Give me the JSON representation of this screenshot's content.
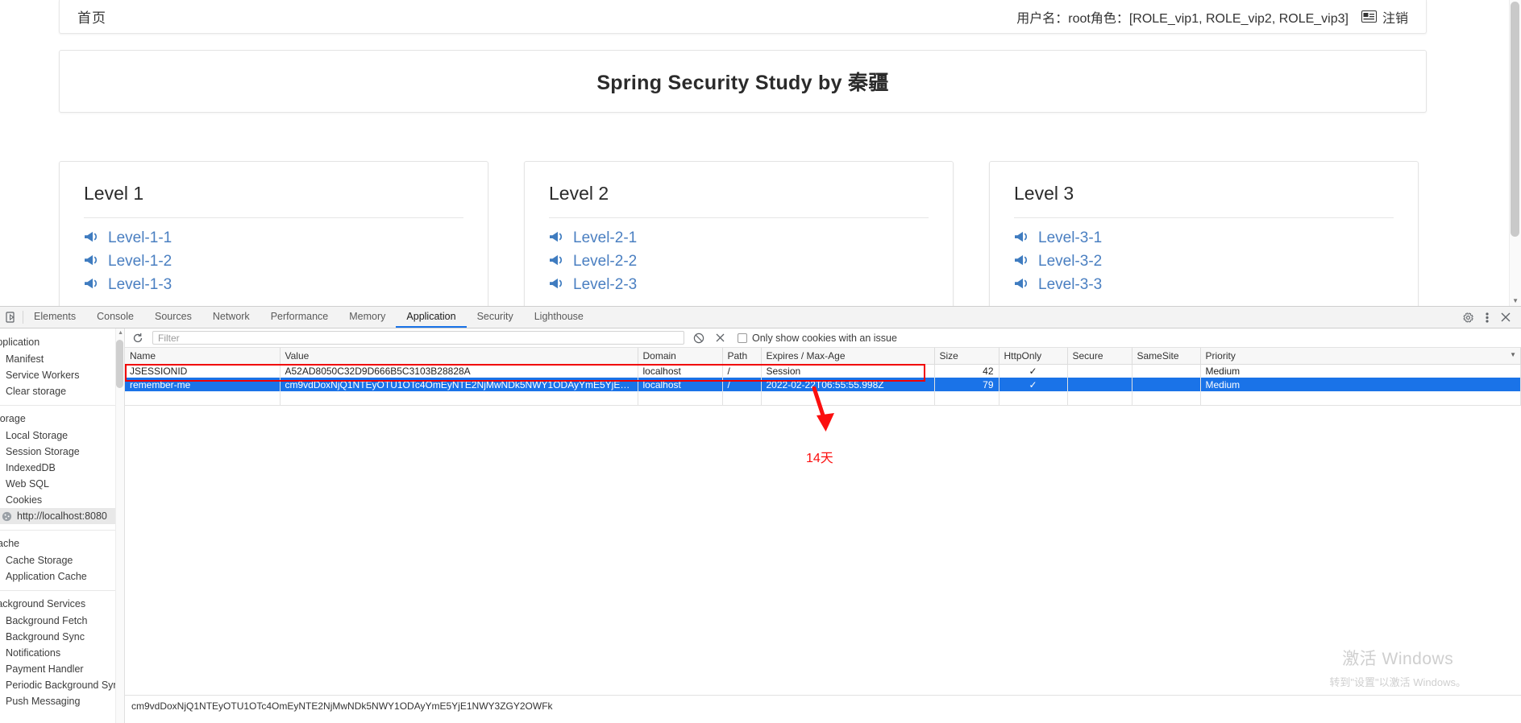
{
  "page": {
    "navbar": {
      "brand": "首页",
      "user_info": "用户名：root角色：[ROLE_vip1, ROLE_vip2, ROLE_vip3]",
      "logout_label": "注销",
      "logout_icon": "logout-card-icon"
    },
    "hero_title": "Spring Security Study by 秦疆",
    "cards": [
      {
        "title": "Level 1",
        "links": [
          "Level-1-1",
          "Level-1-2",
          "Level-1-3"
        ]
      },
      {
        "title": "Level 2",
        "links": [
          "Level-2-1",
          "Level-2-2",
          "Level-2-3"
        ]
      },
      {
        "title": "Level 3",
        "links": [
          "Level-3-1",
          "Level-3-2",
          "Level-3-3"
        ]
      }
    ],
    "link_icon": "megaphone-icon"
  },
  "devtools": {
    "inspect_icon": "inspect-element-icon",
    "tabs": [
      {
        "label": "Elements",
        "active": false
      },
      {
        "label": "Console",
        "active": false
      },
      {
        "label": "Sources",
        "active": false
      },
      {
        "label": "Network",
        "active": false
      },
      {
        "label": "Performance",
        "active": false
      },
      {
        "label": "Memory",
        "active": false
      },
      {
        "label": "Application",
        "active": true
      },
      {
        "label": "Security",
        "active": false
      },
      {
        "label": "Lighthouse",
        "active": false
      }
    ],
    "tabbar_icons": [
      "settings-gear-icon",
      "more-vertical-icon",
      "close-icon"
    ],
    "sidebar": {
      "groups": [
        {
          "title": "Application",
          "items": [
            {
              "label": "Manifest",
              "icon": "manifest-icon",
              "selected": false,
              "nested": false
            },
            {
              "label": "Service Workers",
              "icon": "service-worker-icon",
              "selected": false,
              "nested": false
            },
            {
              "label": "Clear storage",
              "icon": "clear-storage-icon",
              "selected": false,
              "nested": false
            }
          ]
        },
        {
          "title": "Storage",
          "items": [
            {
              "label": "Local Storage",
              "icon": "storage-icon",
              "selected": false,
              "nested": false
            },
            {
              "label": "Session Storage",
              "icon": "storage-icon",
              "selected": false,
              "nested": false
            },
            {
              "label": "IndexedDB",
              "icon": "database-icon",
              "selected": false,
              "nested": false
            },
            {
              "label": "Web SQL",
              "icon": "database-icon",
              "selected": false,
              "nested": false
            },
            {
              "label": "Cookies",
              "icon": "cookie-icon",
              "selected": false,
              "nested": false
            },
            {
              "label": "http://localhost:8080",
              "icon": "cookie-icon",
              "selected": true,
              "nested": true
            }
          ]
        },
        {
          "title": "Cache",
          "items": [
            {
              "label": "Cache Storage",
              "icon": "database-icon",
              "selected": false,
              "nested": false
            },
            {
              "label": "Application Cache",
              "icon": "storage-icon",
              "selected": false,
              "nested": false
            }
          ]
        },
        {
          "title": "Background Services",
          "items": [
            {
              "label": "Background Fetch",
              "icon": "download-arrow-icon",
              "selected": false,
              "nested": false
            },
            {
              "label": "Background Sync",
              "icon": "sync-icon",
              "selected": false,
              "nested": false
            },
            {
              "label": "Notifications",
              "icon": "bell-icon",
              "selected": false,
              "nested": false
            },
            {
              "label": "Payment Handler",
              "icon": "payment-icon",
              "selected": false,
              "nested": false
            },
            {
              "label": "Periodic Background Sync",
              "icon": "clock-sync-icon",
              "selected": false,
              "nested": false
            },
            {
              "label": "Push Messaging",
              "icon": "push-icon",
              "selected": false,
              "nested": false
            }
          ]
        }
      ]
    },
    "toolbar": {
      "refresh_icon": "refresh-icon",
      "filter_placeholder": "Filter",
      "clear_icon": "block-clear-icon",
      "delete_icon": "close-x-icon",
      "issue_checkbox_label": "Only show cookies with an issue",
      "issue_checkbox_checked": false
    },
    "cookie_table": {
      "columns": [
        "Name",
        "Value",
        "Domain",
        "Path",
        "Expires / Max-Age",
        "Size",
        "HttpOnly",
        "Secure",
        "SameSite",
        "Priority"
      ],
      "sort_caret": "▼",
      "rows": [
        {
          "name": "JSESSIONID",
          "value": "A52AD8050C32D9D666B5C3103B28828A",
          "domain": "localhost",
          "path": "/",
          "expires": "Session",
          "size": "42",
          "httponly": "✓",
          "secure": "",
          "samesite": "",
          "priority": "Medium",
          "selected": false
        },
        {
          "name": "remember-me",
          "value": "cm9vdDoxNjQ1NTEyOTU1OTc4OmEyNTE2NjMwNDk5NWY1ODAyYmE5YjE1NW...",
          "domain": "localhost",
          "path": "/",
          "expires": "2022-02-22T06:55:55.998Z",
          "size": "79",
          "httponly": "✓",
          "secure": "",
          "samesite": "",
          "priority": "Medium",
          "selected": true
        }
      ]
    },
    "detail_value": "cm9vdDoxNjQ1NTEyOTU1OTc4OmEyNTE2NjMwNDk5NWY1ODAyYmE5YjE1NWY3ZGY2OWFk"
  },
  "annotations": {
    "expiry_note": "14天",
    "highlight_color": "#f10000",
    "arrow_icon": "down-arrow-annotation-icon"
  },
  "watermark": {
    "line1": "激活 Windows",
    "line2": "转到\"设置\"以激活 Windows。"
  }
}
